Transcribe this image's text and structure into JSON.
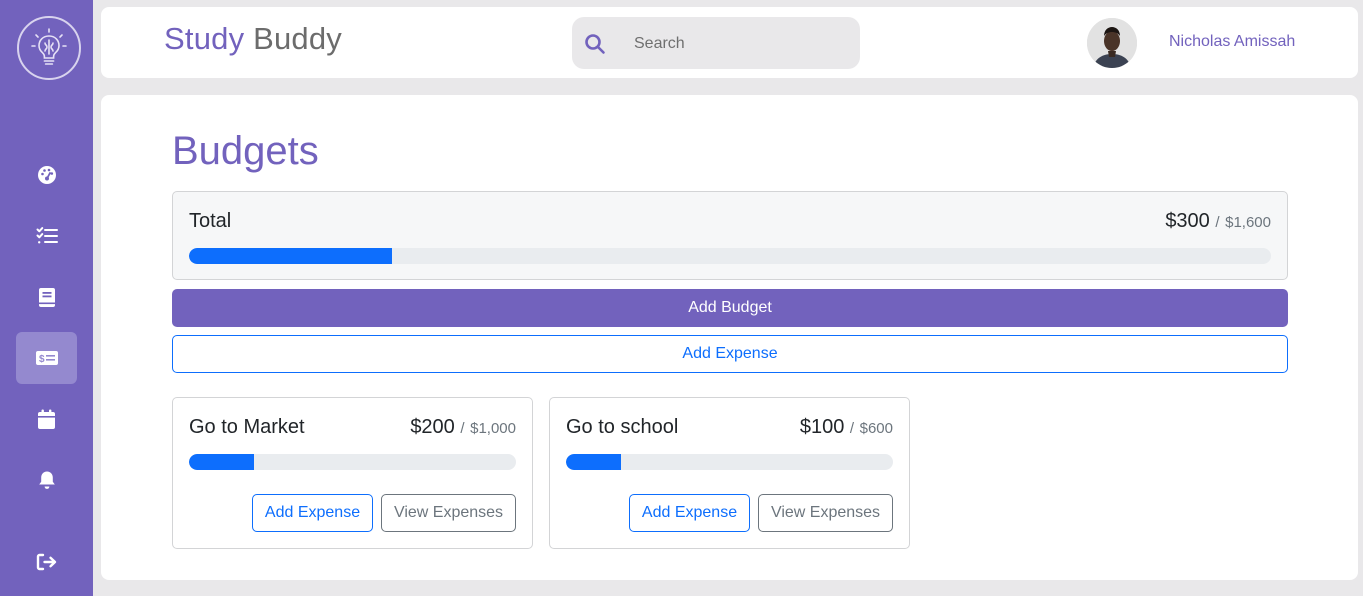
{
  "app": {
    "title_part1": "Study",
    "title_part2": "Buddy",
    "logo_icon": "lightbulb-brain-icon"
  },
  "search": {
    "placeholder": "Search",
    "value": "",
    "icon": "search-icon"
  },
  "user": {
    "name": "Nicholas Amissah",
    "avatar_icon": "user-avatar"
  },
  "sidebar": {
    "items": [
      {
        "icon": "dashboard-icon",
        "active": false
      },
      {
        "icon": "tasks-icon",
        "active": false
      },
      {
        "icon": "book-icon",
        "active": false
      },
      {
        "icon": "money-bill-icon",
        "active": true
      },
      {
        "icon": "calendar-icon",
        "active": false
      },
      {
        "icon": "bell-icon",
        "active": false
      }
    ],
    "logout_icon": "logout-icon"
  },
  "page": {
    "title": "Budgets"
  },
  "total": {
    "label": "Total",
    "spent": "$300",
    "separator": "/",
    "limit": "$1,600",
    "progress": 0.1875
  },
  "buttons": {
    "add_budget": "Add Budget",
    "add_expense": "Add Expense"
  },
  "budgets": [
    {
      "name": "Go to Market",
      "spent": "$200",
      "separator": "/",
      "limit": "$1,000",
      "progress": 0.2,
      "add_expense_label": "Add Expense",
      "view_expenses_label": "View Expenses"
    },
    {
      "name": "Go to school",
      "spent": "$100",
      "separator": "/",
      "limit": "$600",
      "progress": 0.1667,
      "add_expense_label": "Add Expense",
      "view_expenses_label": "View Expenses"
    }
  ],
  "colors": {
    "brand": "#7262bd",
    "sidebar_active": "#9489cf",
    "progress_fill": "#0d6efd",
    "progress_track": "#e9ecef",
    "background": "#e9e8ea"
  }
}
